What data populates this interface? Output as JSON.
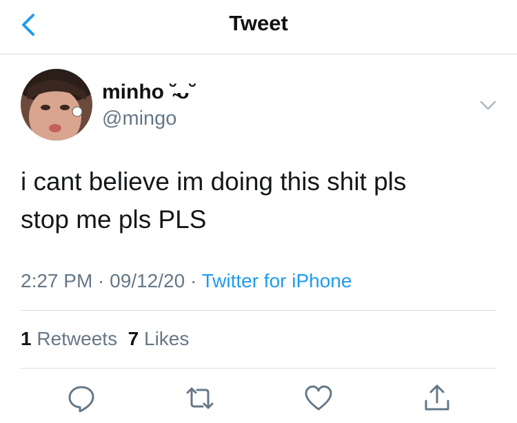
{
  "header": {
    "title": "Tweet",
    "back_icon": "chevron-left-icon"
  },
  "author": {
    "name": "minho ˘̴ᴗ˘",
    "handle": "@mingo"
  },
  "tweet": {
    "line1": "i cant believe im doing this shit pls",
    "line2": "stop me pls PLS"
  },
  "meta": {
    "time": "2:27 PM",
    "sep1": " · ",
    "date": "09/12/20",
    "sep2": " · ",
    "source": "Twitter for iPhone"
  },
  "stats": {
    "retweets_count": "1",
    "retweets_label": "Retweets",
    "likes_count": "7",
    "likes_label": "Likes"
  },
  "actions": [
    "reply-icon",
    "retweet-icon",
    "like-icon",
    "share-icon"
  ],
  "colors": {
    "accent": "#1d9bf0",
    "secondary_text": "#657786",
    "divider": "#d9dfe4"
  }
}
